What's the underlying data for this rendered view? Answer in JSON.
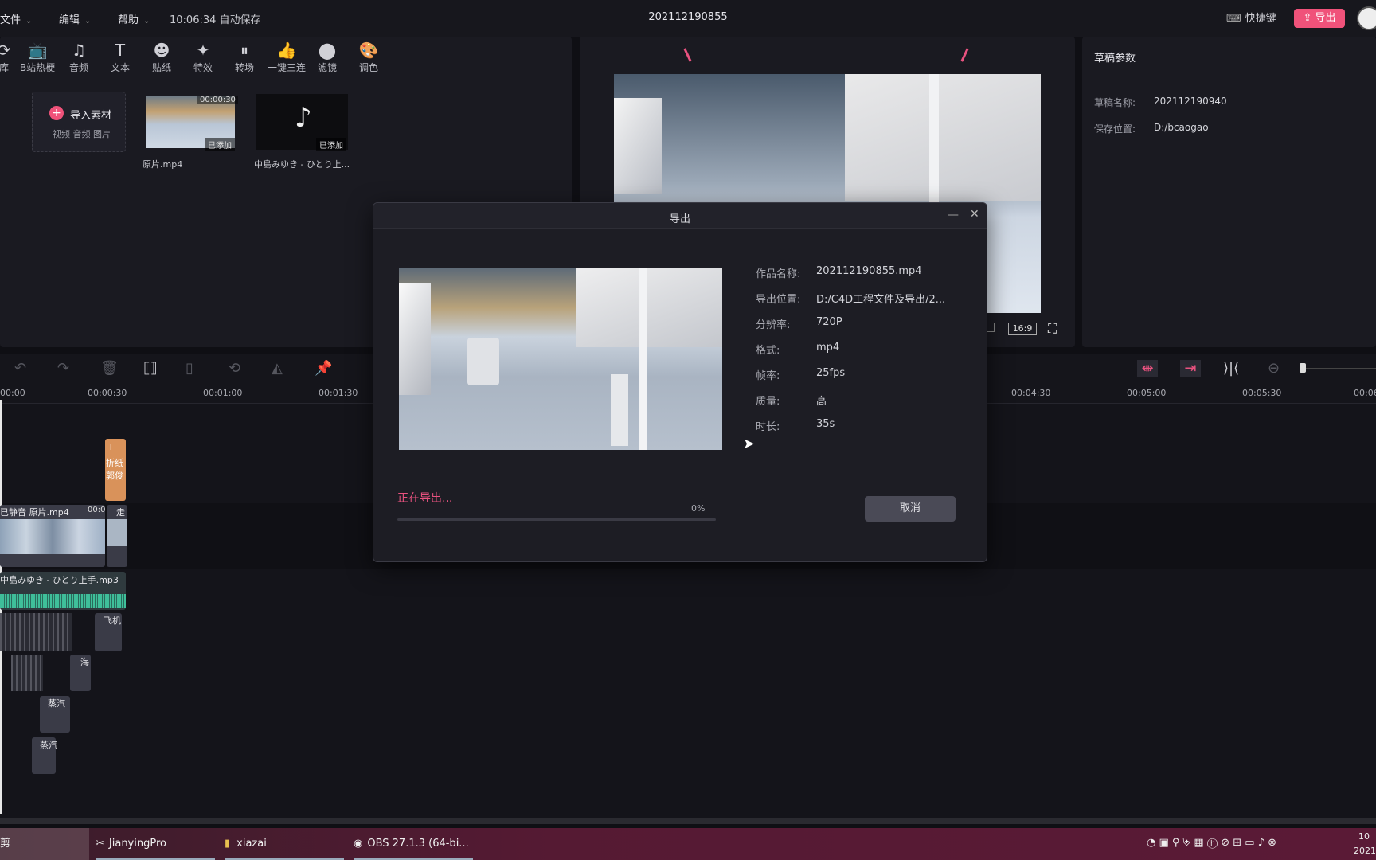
{
  "menubar": {
    "file": "文件",
    "edit": "编辑",
    "help": "帮助",
    "autosave": "10:06:34 自动保存",
    "title": "202112190855",
    "shortcut": "快捷键",
    "export": "导出"
  },
  "toolbar": {
    "items": [
      {
        "label": "库",
        "icon": "library-icon"
      },
      {
        "label": "B站热梗",
        "icon": "bilibili-icon"
      },
      {
        "label": "音频",
        "icon": "music-icon"
      },
      {
        "label": "文本",
        "icon": "text-icon"
      },
      {
        "label": "贴纸",
        "icon": "sticker-icon"
      },
      {
        "label": "特效",
        "icon": "effects-icon"
      },
      {
        "label": "转场",
        "icon": "transition-icon"
      },
      {
        "label": "一键三连",
        "icon": "thumbs-up-icon"
      },
      {
        "label": "滤镜",
        "icon": "filter-icon"
      },
      {
        "label": "调色",
        "icon": "palette-icon"
      }
    ]
  },
  "media": {
    "import_label": "导入素材",
    "import_sub": "视频 音频 图片",
    "items": [
      {
        "name": "原片.mp4",
        "duration": "00:00:30",
        "badge": "已添加"
      },
      {
        "name": "中島みゆき - ひとり上...",
        "duration": "",
        "badge": "已添加"
      }
    ]
  },
  "preview": {
    "ratio": "16:9"
  },
  "draft": {
    "title": "草稿参数",
    "name_key": "草稿名称:",
    "name_val": "202112190940",
    "path_key": "保存位置:",
    "path_val": "D:/bcaogao"
  },
  "timeline": {
    "ticks": [
      "00:00",
      "00:00:30",
      "00:01:00",
      "00:01:30",
      "00:04:30",
      "00:05:00",
      "00:05:30",
      "00:06"
    ],
    "video_clip": "已静音 原片.mp4",
    "video_clip_time": "00:0",
    "text_clip": "折纸 郭俊",
    "text_clip_2": "走",
    "audio_clip": "中島みゆき - ひとり上手.mp3",
    "sfx": [
      "飞机",
      "海",
      "蒸汽",
      "蒸汽"
    ]
  },
  "dialog": {
    "title": "导出",
    "rows": [
      {
        "key": "作品名称:",
        "value": "202112190855.mp4"
      },
      {
        "key": "导出位置:",
        "value": "D:/C4D工程文件及导出/2..."
      },
      {
        "key": "分辨率:",
        "value": "720P"
      },
      {
        "key": "格式:",
        "value": "mp4"
      },
      {
        "key": "帧率:",
        "value": "25fps"
      },
      {
        "key": "质量:",
        "value": "高"
      },
      {
        "key": "时长:",
        "value": "35s"
      }
    ],
    "status": "正在导出...",
    "percent_label": "0%",
    "progress": 0,
    "cancel": "取消"
  },
  "taskbar": {
    "items": [
      "剪",
      "JianyingPro",
      "xiazai",
      "OBS 27.1.3 (64-bi..."
    ],
    "clock": "10",
    "date": "2021"
  },
  "colors": {
    "accent": "#f0527a",
    "panel": "#1a1a21",
    "background": "#0f0f14"
  }
}
